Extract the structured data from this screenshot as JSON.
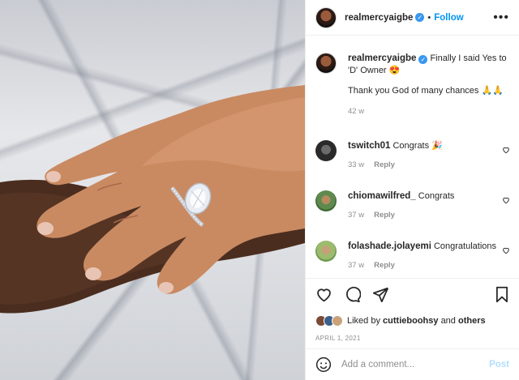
{
  "post": {
    "username": "realmercyaigbe",
    "follow_label": "Follow",
    "more_label": "•••",
    "caption_line1": "Finally I said Yes to 'D' Owner 😍",
    "caption_line2": "Thank you God of many chances 🙏🙏",
    "caption_time": "42 w"
  },
  "comments": [
    {
      "username": "tswitch01",
      "text": "Congrats 🎉",
      "time": "33 w",
      "reply": "Reply",
      "avatar_color": "#3a3a3a"
    },
    {
      "username": "chiomawilfred_",
      "text": "Congrats",
      "time": "37 w",
      "reply": "Reply",
      "avatar_color": "#5f8a4e"
    },
    {
      "username": "folashade.jolayemi",
      "text": "Congratulations",
      "time": "37 w",
      "reply": "Reply",
      "avatar_color": "#7aa36a"
    }
  ],
  "likes": {
    "prefix": "Liked by",
    "user": "cuttieboohsy",
    "joiner": "and",
    "others": "others"
  },
  "date": "APRIL 1, 2021",
  "add_comment": {
    "placeholder": "Add a comment...",
    "post_label": "Post"
  },
  "colors": {
    "link": "#0095f6",
    "post_disabled": "#b2dffc",
    "muted": "#8e8e8e",
    "verified": "#3897f0"
  }
}
